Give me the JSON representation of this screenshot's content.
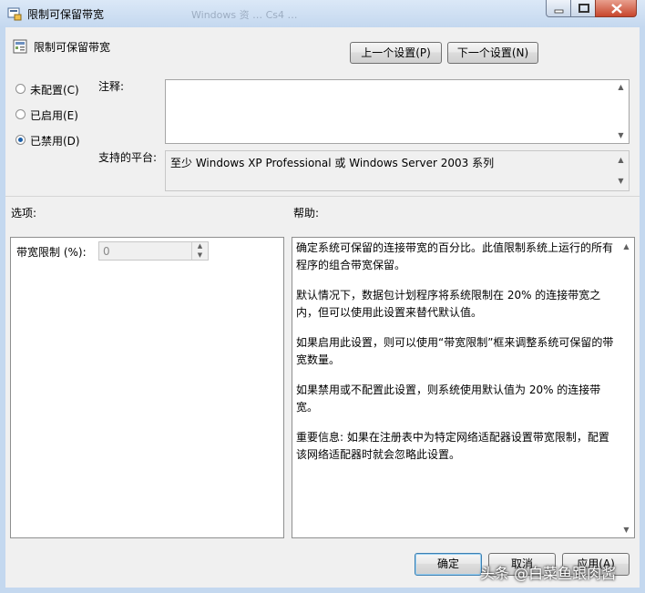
{
  "window": {
    "title": "限制可保留带宽",
    "ghost_tabs": "Windows 资 …  Cs4 …"
  },
  "header": {
    "policy_name": "限制可保留带宽"
  },
  "nav": {
    "prev_label": "上一个设置(P)",
    "next_label": "下一个设置(N)"
  },
  "state_options": [
    {
      "label": "未配置(C)",
      "selected": false
    },
    {
      "label": "已启用(E)",
      "selected": false
    },
    {
      "label": "已禁用(D)",
      "selected": true
    }
  ],
  "comment": {
    "label": "注释:",
    "value": ""
  },
  "platform": {
    "label": "支持的平台:",
    "value": "至少 Windows XP Professional 或 Windows Server 2003 系列"
  },
  "options": {
    "label": "选项:",
    "bandwidth_label": "带宽限制 (%):",
    "bandwidth_value": "0"
  },
  "help": {
    "label": "帮助:",
    "paragraphs": [
      "确定系统可保留的连接带宽的百分比。此值限制系统上运行的所有程序的组合带宽保留。",
      "默认情况下，数据包计划程序将系统限制在 20% 的连接带宽之内，但可以使用此设置来替代默认值。",
      "如果启用此设置，则可以使用“带宽限制”框来调整系统可保留的带宽数量。",
      "如果禁用或不配置此设置，则系统使用默认值为 20% 的连接带宽。",
      "重要信息: 如果在注册表中为特定网络适配器设置带宽限制，配置该网络适配器时就会忽略此设置。"
    ]
  },
  "footer": {
    "ok_label": "确定",
    "cancel_label": "取消",
    "apply_label": "应用(A)"
  },
  "watermark": "头条 @白菜鱼跟肉酱",
  "colors": {
    "titlebar": "#c4d8ef",
    "close_button": "#c7462c",
    "selected_radio": "#1c5fa8"
  }
}
